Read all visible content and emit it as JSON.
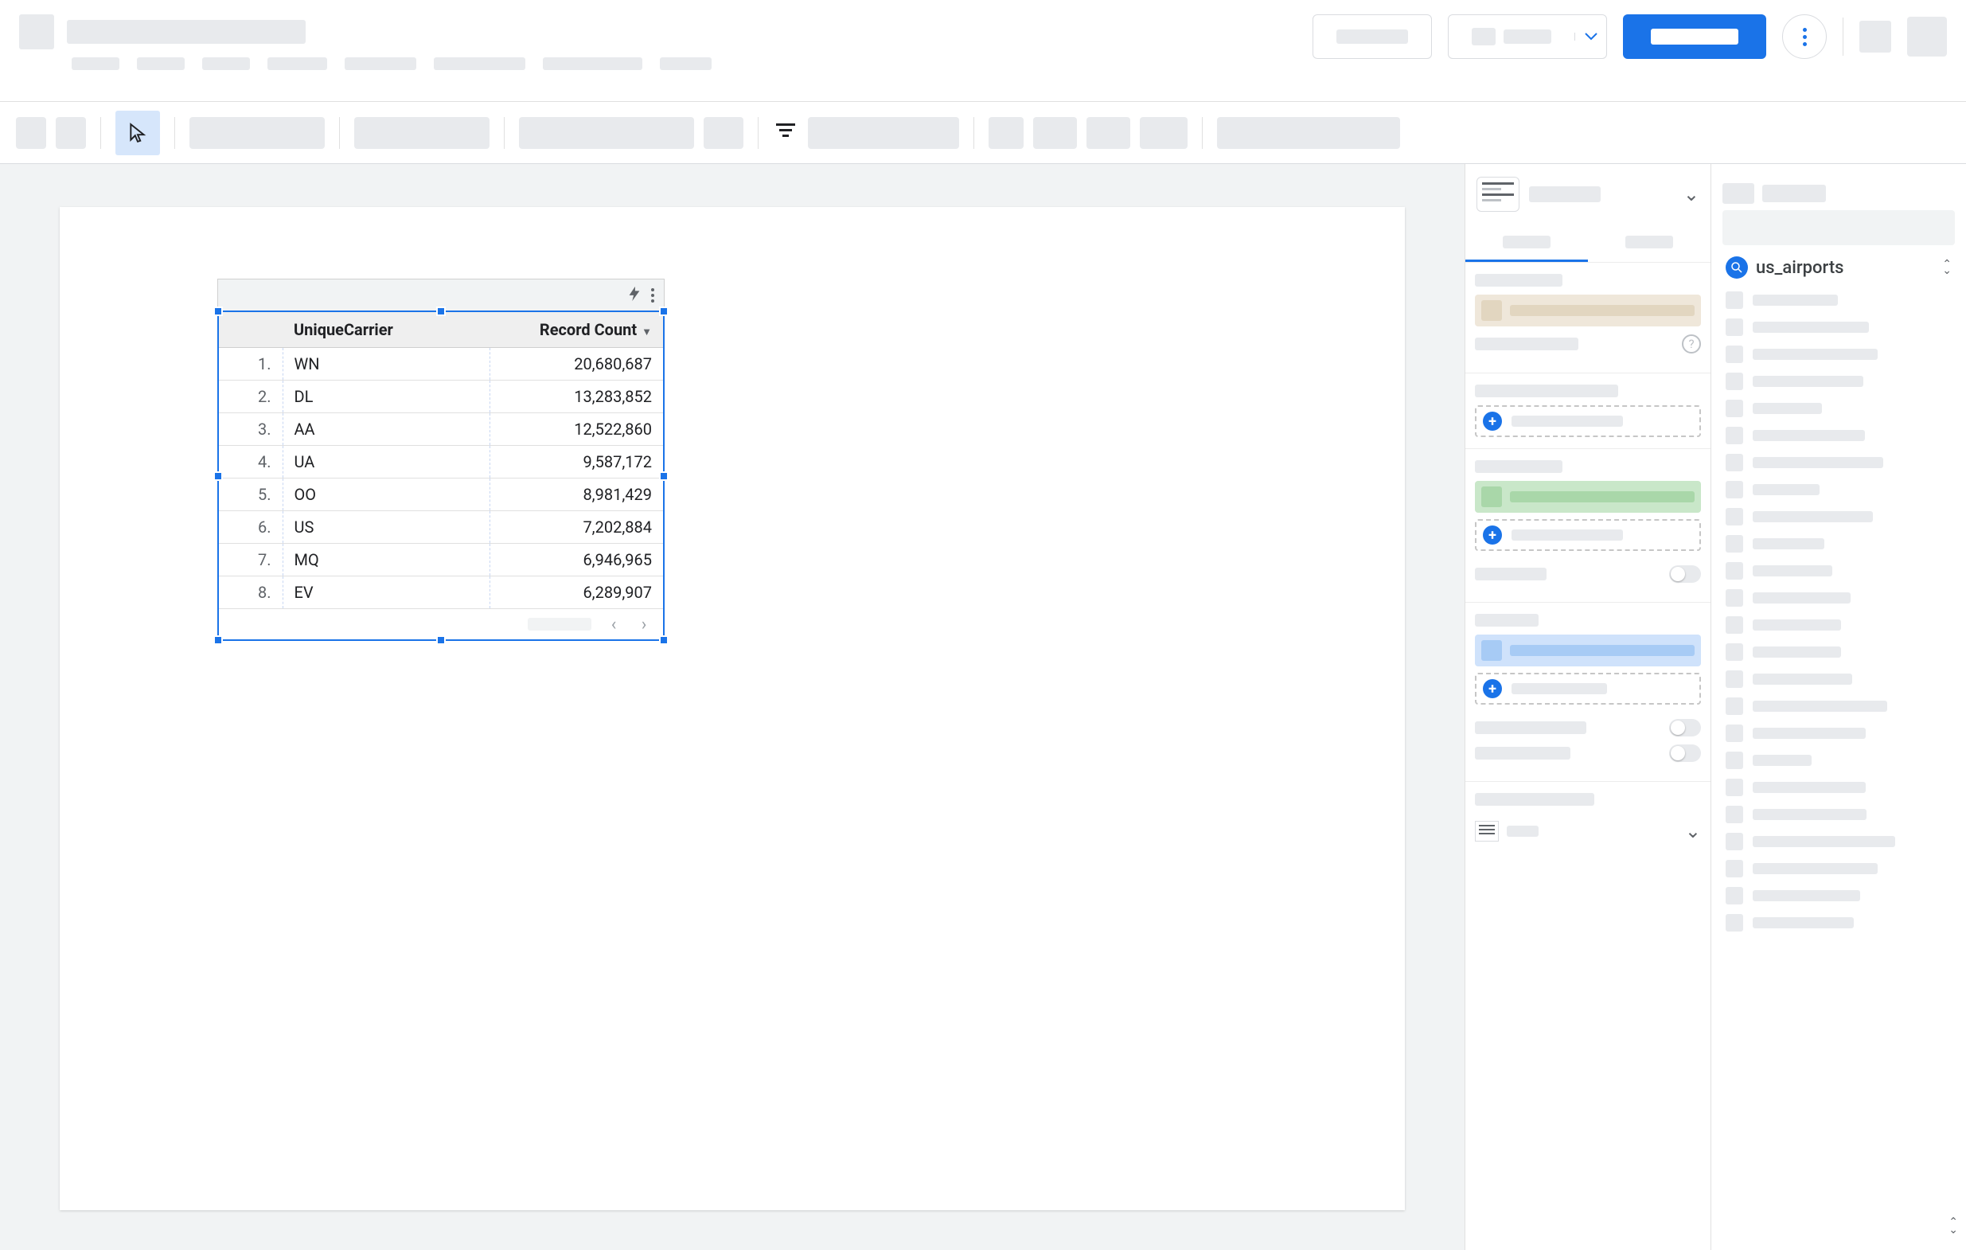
{
  "chart_data": {
    "type": "table",
    "columns": [
      "UniqueCarrier",
      "Record Count"
    ],
    "sort": {
      "column": "Record Count",
      "direction": "desc"
    },
    "rows": [
      {
        "idx": "1.",
        "carrier": "WN",
        "count": "20,680,687"
      },
      {
        "idx": "2.",
        "carrier": "DL",
        "count": "13,283,852"
      },
      {
        "idx": "3.",
        "carrier": "AA",
        "count": "12,522,860"
      },
      {
        "idx": "4.",
        "carrier": "UA",
        "count": "9,587,172"
      },
      {
        "idx": "5.",
        "carrier": "OO",
        "count": "8,981,429"
      },
      {
        "idx": "6.",
        "carrier": "US",
        "count": "7,202,884"
      },
      {
        "idx": "7.",
        "carrier": "MQ",
        "count": "6,946,965"
      },
      {
        "idx": "8.",
        "carrier": "EV",
        "count": "6,289,907"
      }
    ]
  },
  "table_header": {
    "dimension": "UniqueCarrier",
    "metric": "Record Count"
  },
  "data_panel": {
    "source_name": "us_airports"
  }
}
